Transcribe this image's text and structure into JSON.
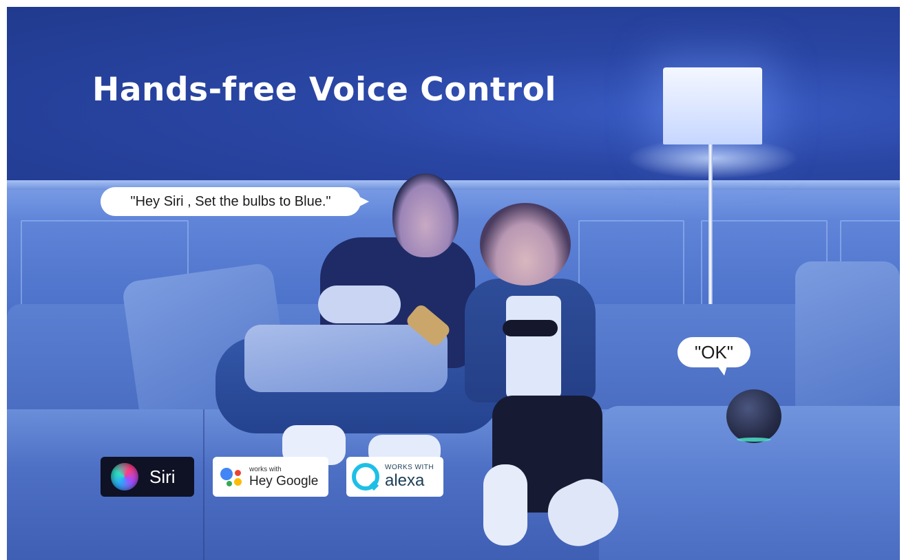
{
  "headline": "Hands-free Voice Control",
  "speech": {
    "user_command": "\"Hey Siri , Set the bulbs to Blue.\"",
    "speaker_reply": "\"OK\""
  },
  "badges": {
    "siri": {
      "label": "Siri"
    },
    "google": {
      "small": "works with",
      "big": "Hey Google"
    },
    "alexa": {
      "small": "WORKS WITH",
      "big": "alexa"
    }
  },
  "colors": {
    "scene_blue": "#2b4aa6",
    "google_blue": "#4285F4",
    "google_red": "#EA4335",
    "google_yellow": "#FBBC05",
    "google_green": "#34A853",
    "alexa_cyan": "#1ebfe6"
  }
}
